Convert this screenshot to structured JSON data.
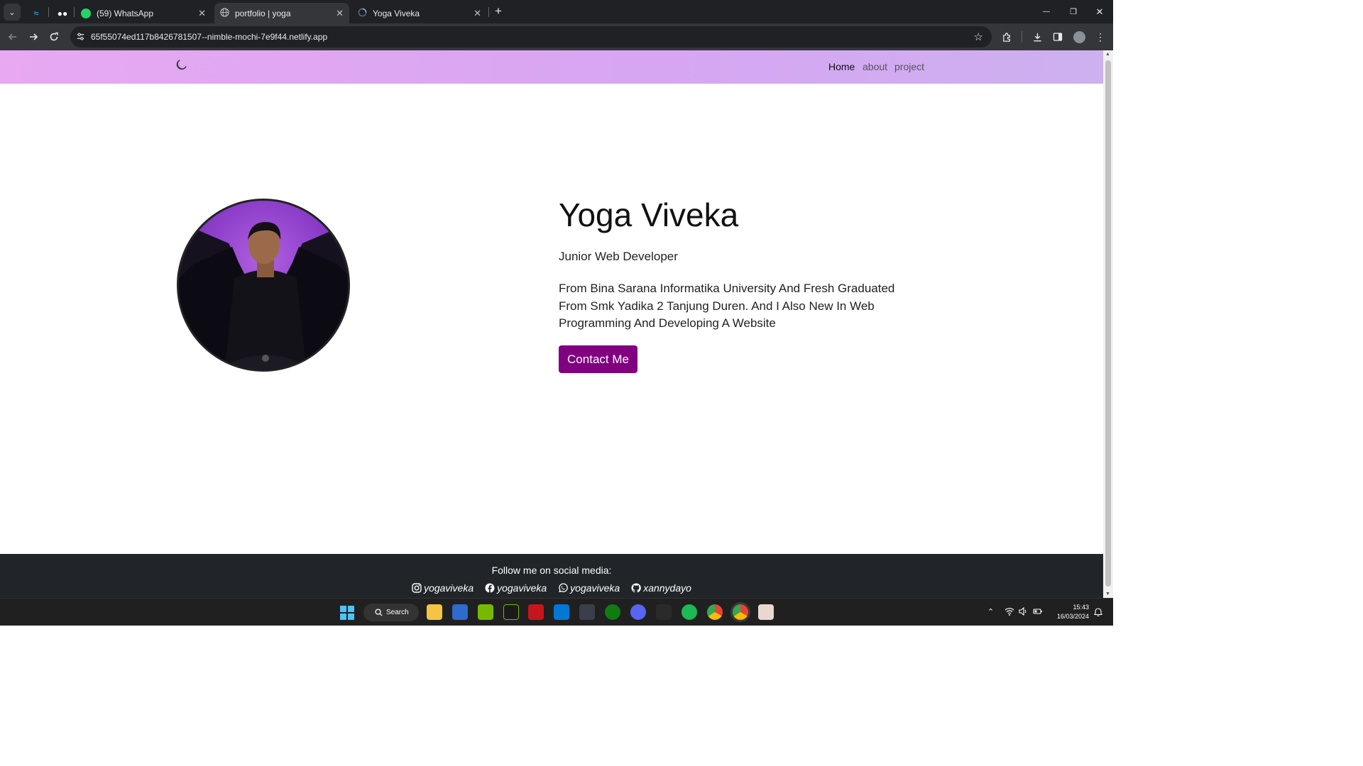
{
  "browser": {
    "tabs": [
      {
        "label": "",
        "icon": "tailwind-icon"
      },
      {
        "label": "",
        "icon": "medium-icon"
      },
      {
        "label": "(59) WhatsApp",
        "icon": "whatsapp-icon"
      },
      {
        "label": "portfolio | yoga",
        "icon": "globe-icon",
        "active": true
      },
      {
        "label": "Yoga Viveka",
        "icon": "loading-icon"
      }
    ],
    "new_tab": "+",
    "url": "65f55074ed117b8426781507--nimble-mochi-7e9f44.netlify.app",
    "window_controls": {
      "minimize": "—",
      "restore": "❐",
      "close": "✕"
    }
  },
  "nav": {
    "theme_toggle_icon": "moon-icon",
    "links": [
      "Home",
      "about",
      "project"
    ]
  },
  "hero": {
    "name": "Yoga Viveka",
    "role": "Junior Web Developer",
    "bio": "From Bina Sarana Informatika University And Fresh Graduated From Smk Yadika 2 Tanjung Duren. And I Also New In Web Programming And Developing A Website",
    "contact_label": "Contact Me",
    "accent": "#800080"
  },
  "footer": {
    "title": "Follow me on social media:",
    "links": [
      {
        "icon": "instagram-icon",
        "label": "yogaviveka"
      },
      {
        "icon": "facebook-icon",
        "label": "yogaviveka"
      },
      {
        "icon": "whatsapp-icon",
        "label": "yogaviveka"
      },
      {
        "icon": "github-icon",
        "label": "xannydayo"
      }
    ]
  },
  "taskbar": {
    "search_label": "Search",
    "time": "15:43",
    "date": "16/03/2024"
  }
}
